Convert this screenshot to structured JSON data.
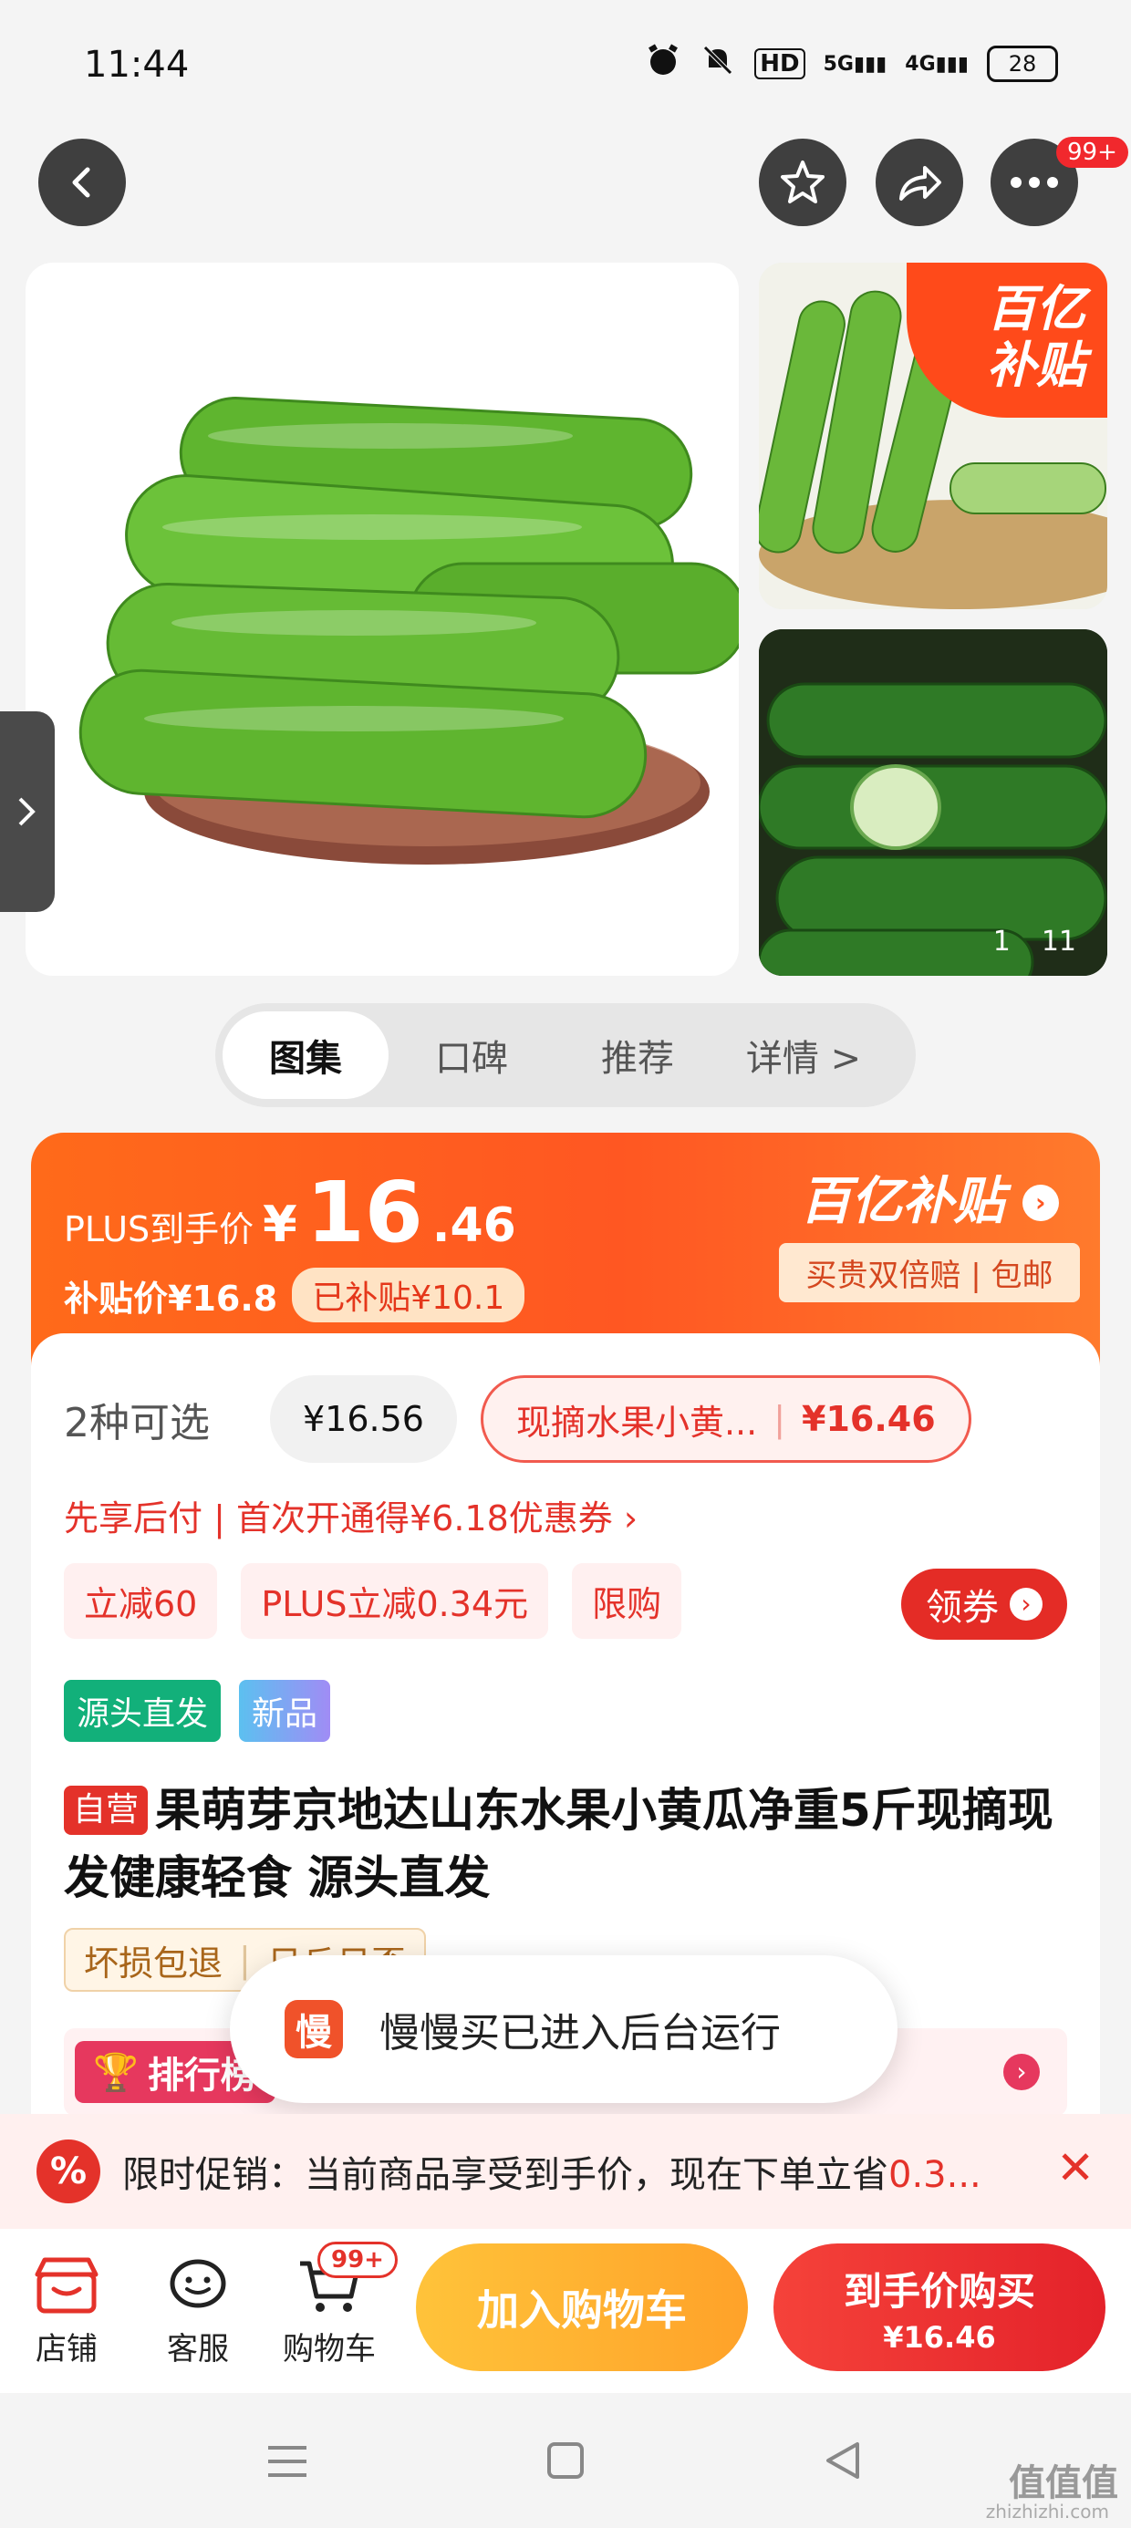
{
  "status_bar": {
    "time": "11:44",
    "network": "5G",
    "network2": "4G",
    "hd": "HD",
    "battery": "28"
  },
  "nav": {
    "cart_badge_top": "99+"
  },
  "gallery": {
    "subsidy_badge_l1": "百亿",
    "subsidy_badge_l2": "补贴",
    "counter_current": "1",
    "counter_total": "11"
  },
  "tabs": [
    {
      "label": "图集"
    },
    {
      "label": "口碑"
    },
    {
      "label": "推荐"
    },
    {
      "label": "详情 >"
    }
  ],
  "price": {
    "label": "PLUS到手价",
    "currency": "¥",
    "integer": "16",
    "decimal": ".46",
    "subsidy_price": "补贴价¥16.8",
    "subsidy_amount": "已补贴¥10.1",
    "brand": "百亿补贴",
    "brand_tag": "买贵双倍赔 | 包邮"
  },
  "variants": {
    "count": "2种可选",
    "option1": "¥16.56",
    "option2_name": "现摘水果小黄...",
    "option2_price": "¥16.46"
  },
  "pay_promo": "先享后付 | 首次开通得¥6.18优惠券 ›",
  "tags": [
    "立减60",
    "PLUS立减0.34元",
    "限购"
  ],
  "coupon_button": "领券",
  "badges": [
    {
      "label": "源头直发",
      "color": "#12b07a"
    },
    {
      "label": "新品",
      "color": "#7aa5f5"
    }
  ],
  "product": {
    "self_tag": "自营",
    "title": "果萌芽京地达山东水果小黄瓜净重5斤现摘现发健康轻食 源头直发"
  },
  "service_chip": [
    "坏损包退",
    "日丘日盃"
  ],
  "rank": {
    "label": "排行榜"
  },
  "toast": {
    "icon_char": "慢",
    "text": "慢慢买已进入后台运行"
  },
  "promo_banner": {
    "prefix": "限时促销：当前商品享受到手价，现在下单立省",
    "highlight": "0.3..."
  },
  "bottom_bar": {
    "shop": "店铺",
    "service": "客服",
    "cart": "购物车",
    "cart_badge": "99+",
    "add_to_cart": "加入购物车",
    "buy_l1": "到手价购买",
    "buy_l2": "¥16.46"
  },
  "watermark": {
    "main": "值值值",
    "sub": "zhizhizhi.com"
  },
  "colors": {
    "accent_red": "#e4322a",
    "price_orange": "#ff5722",
    "cart_yellow": "#ffa229"
  }
}
